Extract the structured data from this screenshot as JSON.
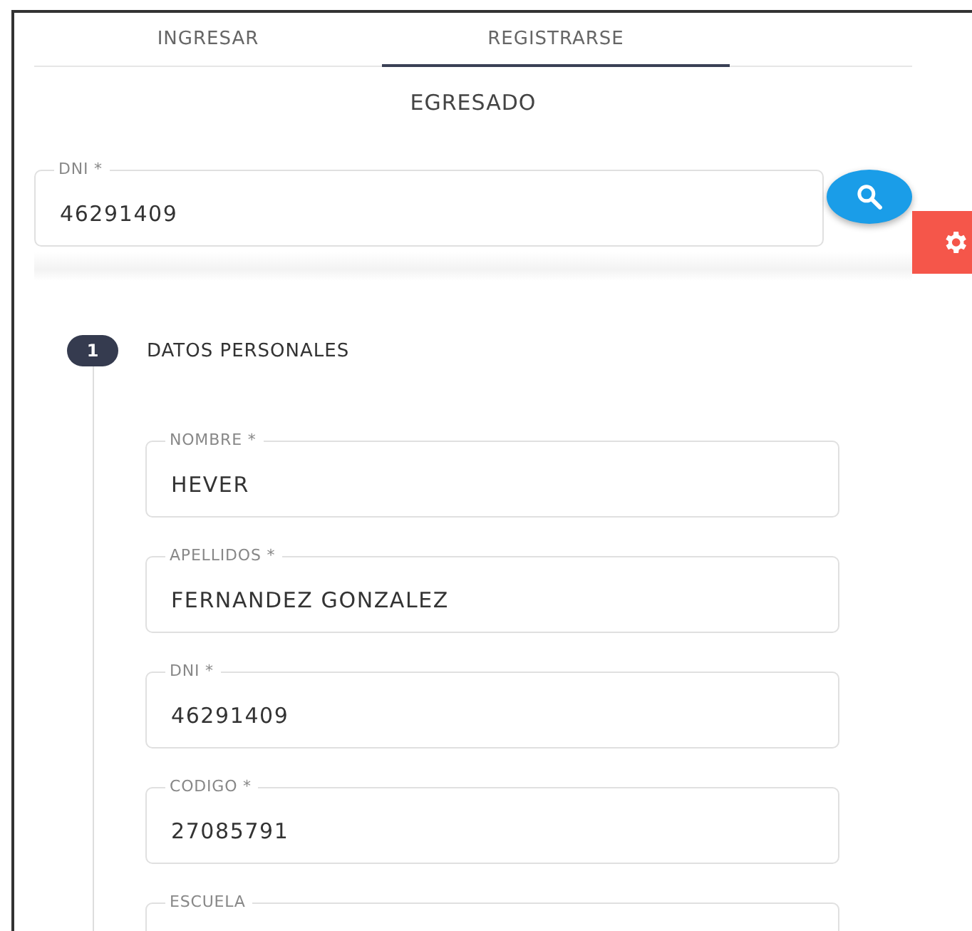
{
  "tabs": [
    {
      "label": "INGRESAR",
      "selected": false
    },
    {
      "label": "REGISTRARSE",
      "selected": true
    }
  ],
  "heading": "EGRESADO",
  "search_field": {
    "label": "DNI *",
    "value": "46291409"
  },
  "step": {
    "number": "1",
    "title": "DATOS PERSONALES"
  },
  "fields": [
    {
      "label": "NOMBRE *",
      "value": "HEVER"
    },
    {
      "label": "APELLIDOS *",
      "value": "FERNANDEZ GONZALEZ"
    },
    {
      "label": "DNI *",
      "value": "46291409"
    },
    {
      "label": "CODIGO *",
      "value": "27085791"
    },
    {
      "label": "ESCUELA"
    }
  ]
}
